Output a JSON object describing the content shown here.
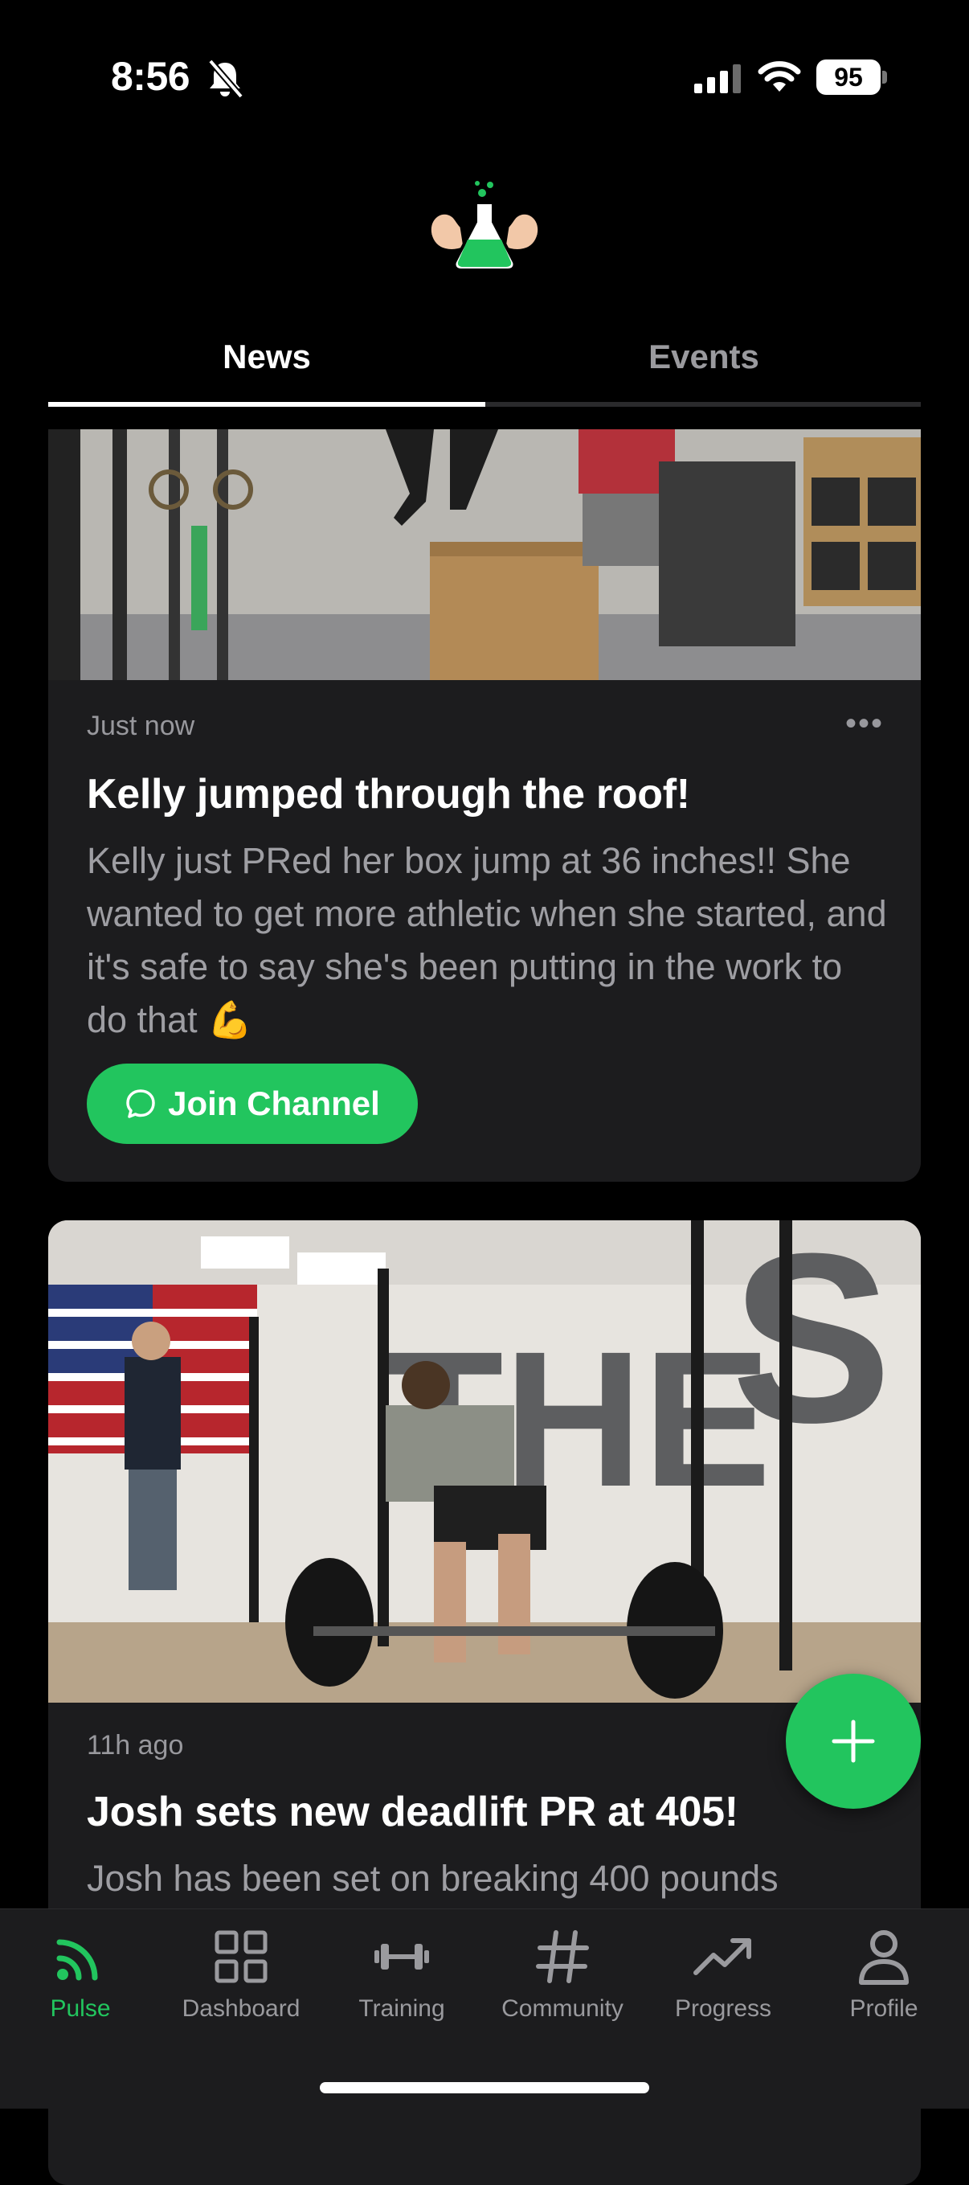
{
  "status_bar": {
    "time": "8:56",
    "battery": "95"
  },
  "tabs": [
    {
      "label": "News",
      "active": true
    },
    {
      "label": "Events",
      "active": false
    }
  ],
  "posts": [
    {
      "timestamp": "Just now",
      "title": "Kelly jumped through the roof!",
      "body": "Kelly just PRed her box jump at 36 inches!! She wanted to get more athletic when she started, and it's safe to say she's been putting in the work to do that 💪",
      "button_label": "Join Channel",
      "more_label": "•••"
    },
    {
      "timestamp": "11h ago",
      "title": "Josh sets new deadlift PR at 405!",
      "body": "Josh has been set on breaking 400 pounds"
    }
  ],
  "fab": {
    "icon": "plus-icon"
  },
  "nav": [
    {
      "label": "Pulse",
      "icon": "pulse-icon",
      "active": true
    },
    {
      "label": "Dashboard",
      "icon": "dashboard-icon",
      "active": false
    },
    {
      "label": "Training",
      "icon": "dumbbell-icon",
      "active": false
    },
    {
      "label": "Community",
      "icon": "hashtag-icon",
      "active": false
    },
    {
      "label": "Progress",
      "icon": "trend-icon",
      "active": false
    },
    {
      "label": "Profile",
      "icon": "person-icon",
      "active": false
    }
  ],
  "colors": {
    "accent": "#22c55e",
    "card": "#1c1c1e",
    "background": "#000000"
  }
}
